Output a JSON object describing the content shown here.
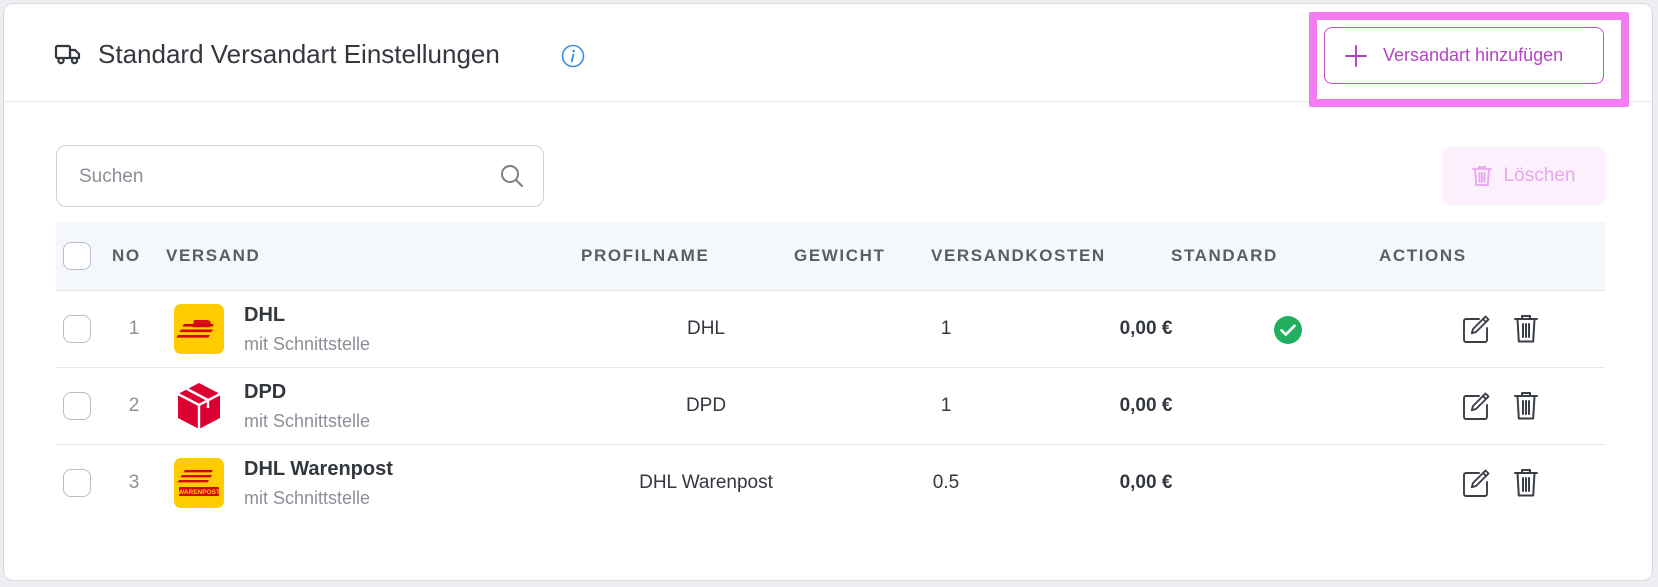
{
  "header": {
    "title": "Standard Versandart Einstellungen",
    "add_button_label": "Versandart hinzufügen"
  },
  "toolbar": {
    "search_placeholder": "Suchen",
    "search_value": "",
    "delete_label": "Löschen"
  },
  "table": {
    "columns": [
      "NO",
      "VERSAND",
      "PROFILNAME",
      "GEWICHT",
      "VERSANDKOSTEN",
      "STANDARD",
      "ACTIONS"
    ],
    "rows": [
      {
        "no": "1",
        "name": "DHL",
        "subtitle": "mit Schnittstelle",
        "profilname": "DHL",
        "gewicht": "1",
        "versandkosten": "0,00 €",
        "standard": true,
        "logo": "dhl-logo-icon"
      },
      {
        "no": "2",
        "name": "DPD",
        "subtitle": "mit Schnittstelle",
        "profilname": "DPD",
        "gewicht": "1",
        "versandkosten": "0,00 €",
        "standard": false,
        "logo": "dpd-logo-icon"
      },
      {
        "no": "3",
        "name": "DHL Warenpost",
        "subtitle": "mit Schnittstelle",
        "profilname": "DHL Warenpost",
        "gewicht": "0.5",
        "versandkosten": "0,00 €",
        "standard": false,
        "logo": "dhl-warenpost-logo-icon"
      }
    ]
  },
  "icons": {
    "header": "truck-icon",
    "info": "info-icon",
    "add": "plus-icon",
    "search": "search-icon",
    "delete": "trash-icon",
    "standard": "check-circle-icon",
    "edit": "edit-icon"
  },
  "colors": {
    "accent": "#b741c8",
    "highlight": "#f47cf2",
    "success": "#22b060",
    "info": "#3b8ee0",
    "dhl_yellow": "#ffcc00",
    "dhl_red": "#d40511",
    "dpd_red": "#dc0032"
  }
}
